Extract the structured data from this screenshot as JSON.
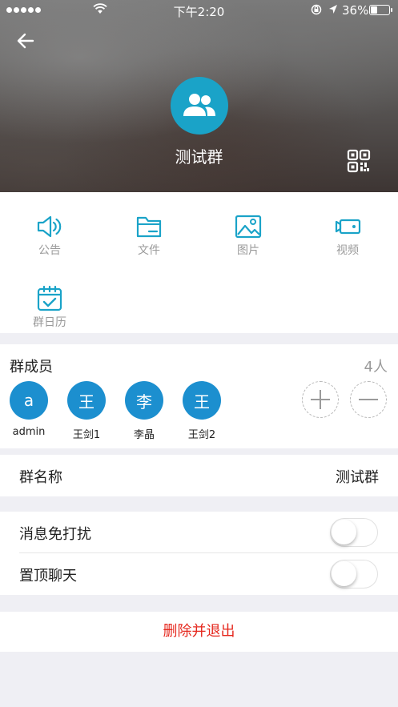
{
  "status_bar": {
    "time": "下午2:20",
    "battery_percent": "36%",
    "battery_level": 0.36
  },
  "header": {
    "group_name": "测试群",
    "back_icon": "arrow-left-icon",
    "qr_icon": "qr-code-icon",
    "avatar_icon": "group-people-icon"
  },
  "functions": [
    {
      "label": "公告",
      "icon": "speaker-icon"
    },
    {
      "label": "文件",
      "icon": "folder-icon"
    },
    {
      "label": "图片",
      "icon": "image-icon"
    },
    {
      "label": "视频",
      "icon": "video-camera-icon"
    },
    {
      "label": "群日历",
      "icon": "calendar-icon"
    }
  ],
  "members": {
    "title": "群成员",
    "count": "4人",
    "list": [
      {
        "avatar": "a",
        "name": "admin"
      },
      {
        "avatar": "王",
        "name": "王剑1"
      },
      {
        "avatar": "李",
        "name": "李晶"
      },
      {
        "avatar": "王",
        "name": "王剑2"
      }
    ],
    "add_icon": "plus-icon",
    "remove_icon": "minus-icon"
  },
  "group_name_row": {
    "label": "群名称",
    "value": "测试群"
  },
  "settings": {
    "mute_label": "消息免打扰",
    "mute_on": false,
    "pin_label": "置顶聊天",
    "pin_on": false
  },
  "delete_exit_label": "删除并退出",
  "colors": {
    "accent": "#1aa3c8",
    "member_avatar": "#1c8fcf",
    "danger": "#e5281e",
    "background": "#efeff4"
  }
}
